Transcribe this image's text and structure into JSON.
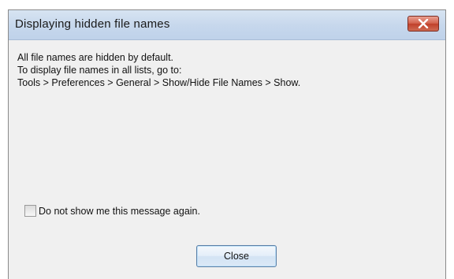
{
  "dialog": {
    "title": "Displaying hidden file names",
    "close_icon": "close-icon",
    "message_lines": [
      "All file names are hidden by default.",
      "To display file names in all lists, go to:",
      "Tools > Preferences > General > Show/Hide File Names > Show."
    ],
    "checkbox_label": "Do not show me this message again.",
    "checkbox_checked": false,
    "close_button_label": "Close",
    "colors": {
      "titlebar": "#c6d7ec",
      "close_x": "#c0402a",
      "body": "#f0f0f0"
    }
  }
}
